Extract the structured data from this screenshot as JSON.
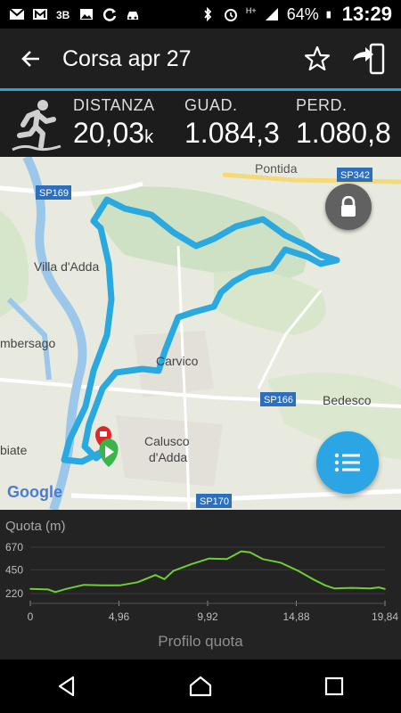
{
  "status_bar": {
    "battery": "64%",
    "time": "13:29",
    "network": "H+"
  },
  "appbar": {
    "title": "Corsa apr 27"
  },
  "stats": {
    "distance": {
      "label": "DISTANZA",
      "value": "20,03",
      "unit": "k"
    },
    "gain": {
      "label": "GUAD.",
      "value": "1.084,3"
    },
    "loss": {
      "label": "PERD.",
      "value": "1.080,8"
    }
  },
  "map": {
    "places": {
      "pontida": "Pontida",
      "villa_dadda": "Villa d'Adda",
      "imbersago": "mbersago",
      "carvico": "Carvico",
      "bedesco": "Bedesco",
      "calusco_1": "Calusco",
      "calusco_2": "d'Adda",
      "biate": "biate"
    },
    "roads": {
      "sp169": "SP169",
      "sp342": "SP342",
      "sp166": "SP166",
      "sp170": "SP170"
    },
    "attribution": "Google",
    "route_color": "#2aa8e0"
  },
  "chart": {
    "ylabel": "Quota (m)",
    "footer": "Profilo quota",
    "y_ticks": [
      "670",
      "450",
      "220"
    ],
    "x_ticks": [
      "0",
      "4,96",
      "9,92",
      "14,88",
      "19,84"
    ]
  },
  "chart_data": {
    "type": "area",
    "ylabel": "Quota (m)",
    "xlabel": "Profilo quota",
    "xlim": [
      0,
      19.84
    ],
    "ylim": [
      220,
      670
    ],
    "line_color": "#6fcf2e",
    "x": [
      0,
      1,
      1.4,
      2,
      3,
      4,
      5,
      6,
      7,
      7.5,
      8,
      9,
      10,
      11,
      11.8,
      12.3,
      13,
      14,
      15,
      15.8,
      16.5,
      17,
      18,
      19,
      19.5,
      19.84
    ],
    "y": [
      265,
      260,
      235,
      265,
      305,
      300,
      300,
      330,
      400,
      360,
      440,
      505,
      560,
      555,
      630,
      620,
      555,
      520,
      440,
      360,
      300,
      270,
      275,
      270,
      280,
      265
    ]
  }
}
